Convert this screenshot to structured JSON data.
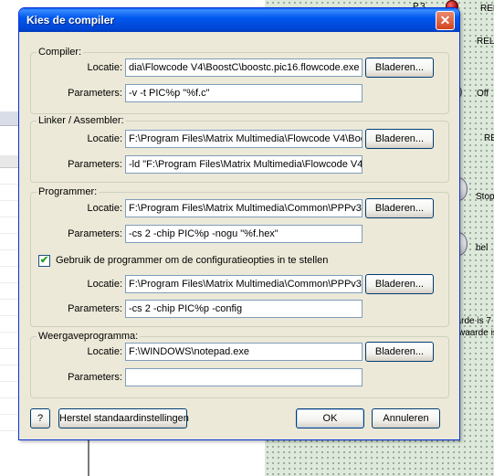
{
  "background": {
    "labels": [
      "P.3",
      "REL",
      "REL",
      "Off",
      "RE",
      "Stop",
      "bel",
      "aarde is 7",
      "waarde is"
    ]
  },
  "dialog": {
    "title": "Kies de compiler",
    "close_glyph": "✕",
    "groups": {
      "compiler": {
        "legend": "Compiler:",
        "locatie_label": "Locatie:",
        "locatie_value": "dia\\Flowcode V4\\BoostC\\boostc.pic16.flowcode.exe",
        "parameters_label": "Parameters:",
        "parameters_value": "-v -t PIC%p \"%f.c\"",
        "browse_label": "Bladeren..."
      },
      "linker": {
        "legend": "Linker / Assembler:",
        "locatie_label": "Locatie:",
        "locatie_value": "F:\\Program Files\\Matrix Multimedia\\Flowcode V4\\Boo",
        "parameters_label": "Parameters:",
        "parameters_value": "-ld \"F:\\Program Files\\Matrix Multimedia\\Flowcode V4\\",
        "browse_label": "Bladeren..."
      },
      "programmer": {
        "legend": "Programmer:",
        "locatie_label": "Locatie:",
        "locatie_value": "F:\\Program Files\\Matrix Multimedia\\Common\\PPPv3\\",
        "parameters_label": "Parameters:",
        "parameters_value": "-cs 2 -chip PIC%p -nogu \"%f.hex\"",
        "browse_label": "Bladeren...",
        "config_checkbox_label": "Gebruik de programmer om de configuratieopties in te  stellen",
        "config_checked": "✔",
        "config_locatie_label": "Locatie:",
        "config_locatie_value": "F:\\Program Files\\Matrix Multimedia\\Common\\PPPv3\\",
        "config_parameters_label": "Parameters:",
        "config_parameters_value": "-cs 2 -chip PIC%p -config",
        "config_browse_label": "Bladeren..."
      },
      "viewer": {
        "legend": "Weergaveprogramma:",
        "locatie_label": "Locatie:",
        "locatie_value": "F:\\WINDOWS\\notepad.exe",
        "parameters_label": "Parameters:",
        "parameters_value": "",
        "browse_label": "Bladeren..."
      }
    },
    "footer": {
      "help_label": "?",
      "restore_label": "Herstel standaardinstellingen",
      "ok_label": "OK",
      "cancel_label": "Annuleren"
    }
  }
}
